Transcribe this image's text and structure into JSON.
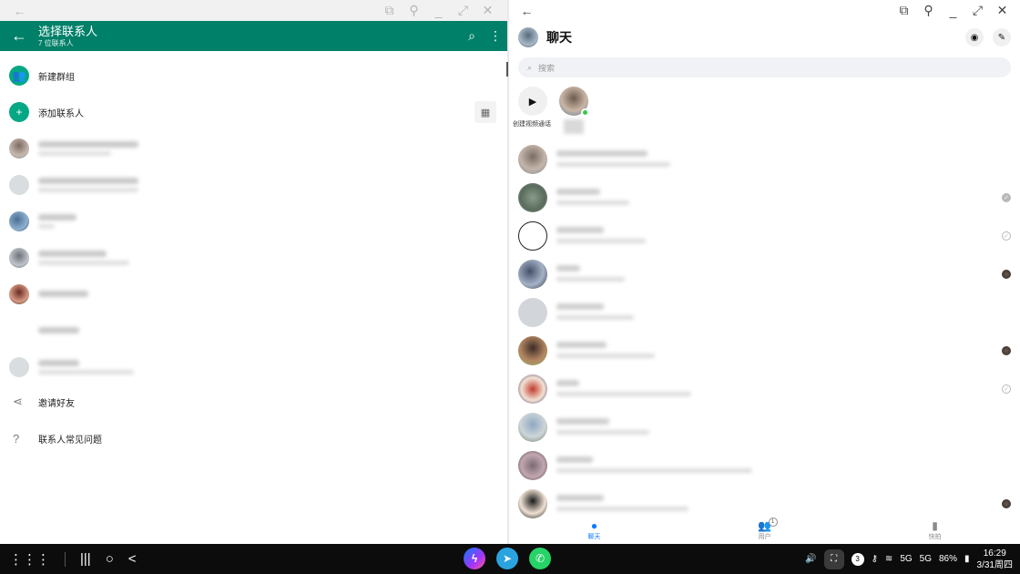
{
  "whatsapp": {
    "header": {
      "title": "选择联系人",
      "subtitle": "7 位联系人"
    },
    "actions": [
      {
        "label": "新建群组",
        "icon": "group-icon"
      },
      {
        "label": "添加联系人",
        "icon": "add-person-icon"
      }
    ],
    "footer_actions": [
      {
        "label": "邀请好友",
        "icon": "share-icon"
      },
      {
        "label": "联系人常见问题",
        "icon": "help-icon"
      }
    ]
  },
  "messenger": {
    "header": {
      "title": "聊天"
    },
    "search": {
      "placeholder": "搜索"
    },
    "stories": {
      "create_label": "创建视频通话"
    },
    "tabs": [
      {
        "label": "聊天",
        "active": true
      },
      {
        "label": "用户",
        "badge": "1"
      },
      {
        "label": "快拍"
      }
    ]
  },
  "taskbar": {
    "pinned_apps": [
      "messenger-icon",
      "telegram-icon",
      "whatsapp-icon"
    ],
    "notification_count": "3",
    "network_5g_1": "5G",
    "network_5g_2": "5G",
    "battery": "86%",
    "time": "16:29",
    "date": "3/31周四"
  },
  "colors": {
    "whatsapp_green": "#008069",
    "whatsapp_accent": "#05a884",
    "messenger_blue": "#0a7cff",
    "online_green": "#31cc46"
  }
}
